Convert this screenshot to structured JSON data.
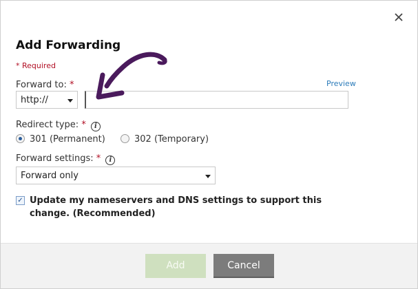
{
  "dialog": {
    "title": "Add Forwarding",
    "close_icon": "close-icon",
    "required_note": "* Required"
  },
  "forward_to": {
    "label": "Forward to:",
    "required_mark": "*",
    "preview_link": "Preview",
    "protocol_selected": "http://",
    "url_value": "",
    "url_placeholder": ""
  },
  "redirect_type": {
    "label": "Redirect type:",
    "required_mark": "*",
    "info_icon": "i",
    "options": [
      {
        "label": "301 (Permanent)",
        "selected": true
      },
      {
        "label": "302 (Temporary)",
        "selected": false
      }
    ]
  },
  "forward_settings": {
    "label": "Forward settings:",
    "required_mark": "*",
    "info_icon": "i",
    "selected": "Forward only"
  },
  "update_dns": {
    "checked": true,
    "label": "Update my nameservers and DNS settings to support this change. (Recommended)"
  },
  "footer": {
    "add_label": "Add",
    "cancel_label": "Cancel"
  },
  "colors": {
    "required_red": "#b10f24",
    "link_blue": "#2b7bb9",
    "add_button_disabled": "#cfe0bf",
    "cancel_button": "#7c7c7c",
    "annotation_arrow": "#4a1a5c"
  }
}
